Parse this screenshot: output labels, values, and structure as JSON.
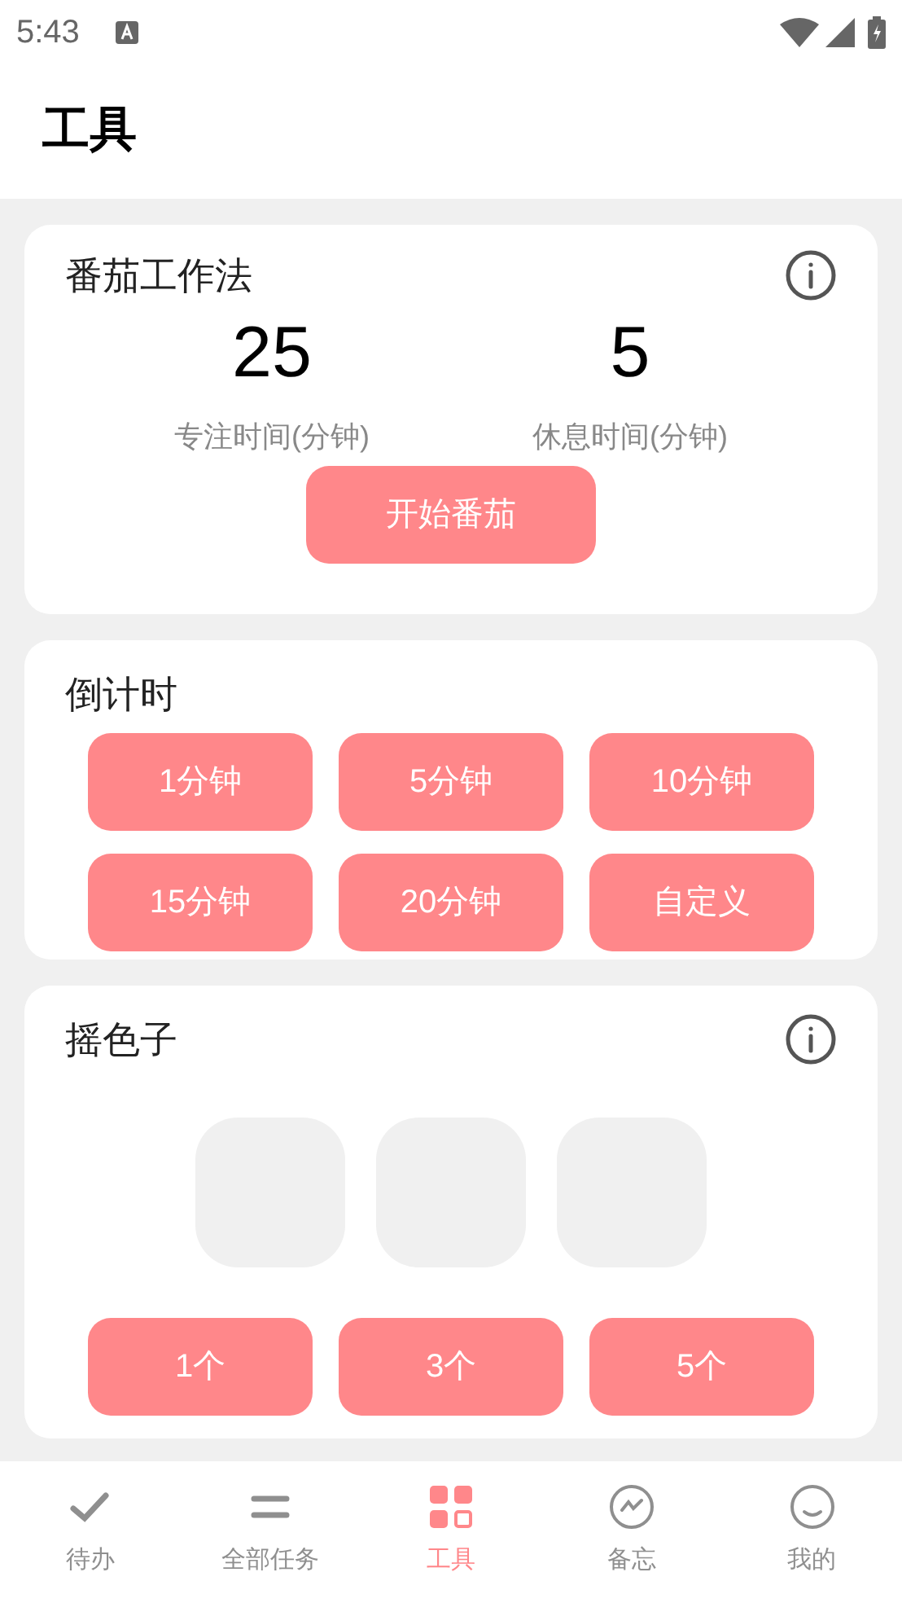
{
  "status_bar": {
    "time": "5:43"
  },
  "header": {
    "title": "工具"
  },
  "pomodoro": {
    "title": "番茄工作法",
    "stats": [
      {
        "value": "25",
        "label": "专注时间(分钟)"
      },
      {
        "value": "5",
        "label": "休息时间(分钟)"
      }
    ],
    "button": "开始番茄"
  },
  "countdown": {
    "title": "倒计时",
    "buttons": [
      "1分钟",
      "5分钟",
      "10分钟",
      "15分钟",
      "20分钟",
      "自定义"
    ]
  },
  "dice": {
    "title": "摇色子",
    "slots": [
      {
        "kind": "empty"
      },
      {
        "kind": "empty"
      },
      {
        "kind": "empty"
      }
    ],
    "buttons": [
      "1个",
      "3个",
      "5个"
    ]
  },
  "nav": [
    {
      "label": "待办",
      "selected": false
    },
    {
      "label": "全部任务",
      "selected": false
    },
    {
      "label": "工具",
      "selected": true
    },
    {
      "label": "备忘",
      "selected": false
    },
    {
      "label": "我的",
      "selected": false
    }
  ]
}
